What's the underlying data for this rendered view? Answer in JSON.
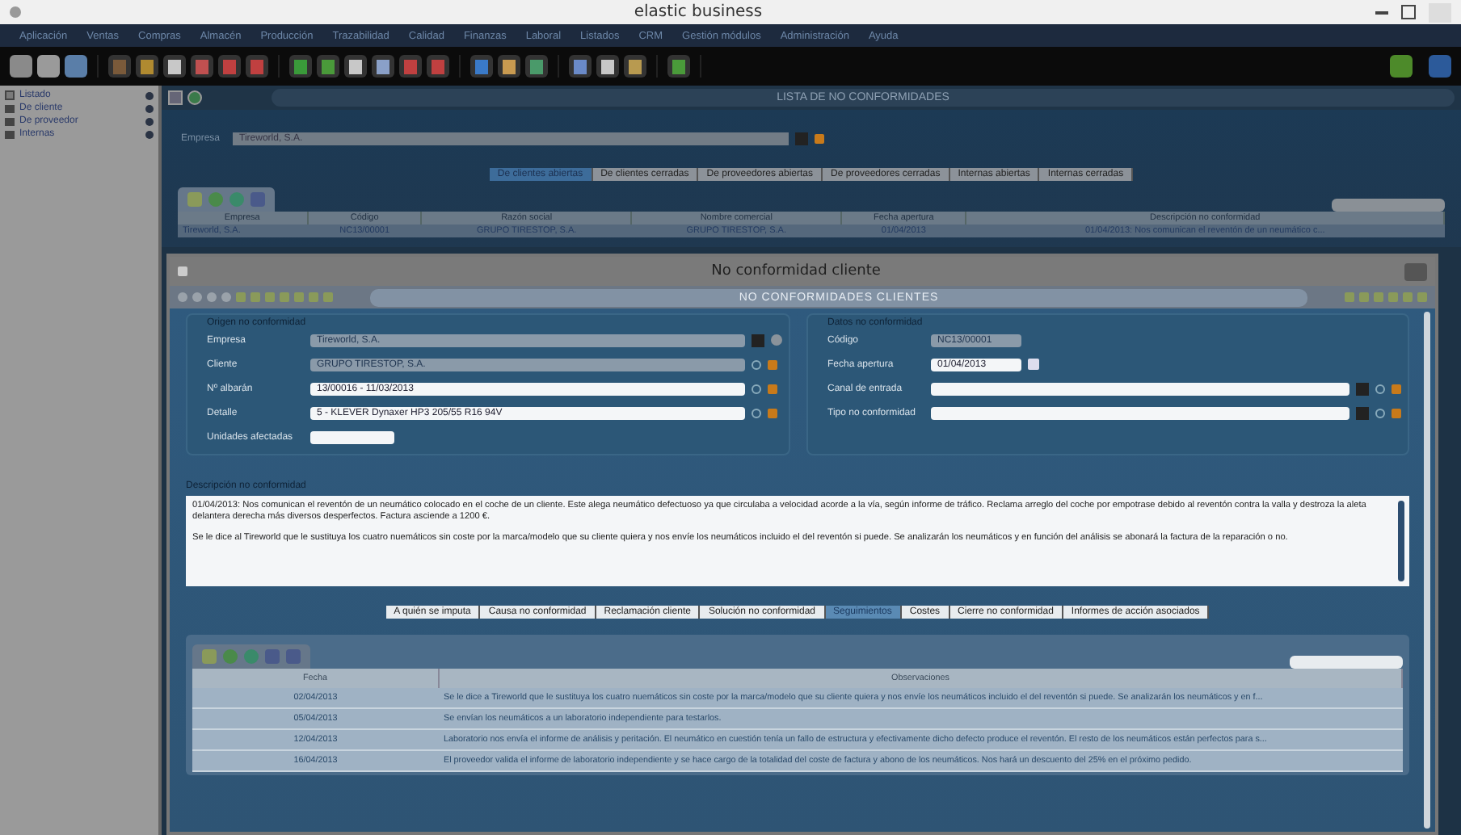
{
  "window": {
    "title": "elastic business"
  },
  "menu": [
    "Aplicación",
    "Ventas",
    "Compras",
    "Almacén",
    "Producción",
    "Trazabilidad",
    "Calidad",
    "Finanzas",
    "Laboral",
    "Listados",
    "CRM",
    "Gestión módulos",
    "Administración",
    "Ayuda"
  ],
  "sidebar": {
    "items": [
      {
        "label": "Listado",
        "kind": "list"
      },
      {
        "label": "De cliente",
        "kind": "folder"
      },
      {
        "label": "De proveedor",
        "kind": "folder"
      },
      {
        "label": "Internas",
        "kind": "folder"
      }
    ]
  },
  "list": {
    "title": "LISTA DE NO CONFORMIDADES",
    "empresa_label": "Empresa",
    "empresa_value": "Tireworld, S.A.",
    "tabs": [
      {
        "label": "De clientes abiertas",
        "selected": true
      },
      {
        "label": "De clientes cerradas",
        "selected": false
      },
      {
        "label": "De proveedores abiertas",
        "selected": false
      },
      {
        "label": "De proveedores cerradas",
        "selected": false
      },
      {
        "label": "Internas abiertas",
        "selected": false
      },
      {
        "label": "Internas cerradas",
        "selected": false
      }
    ],
    "columns": [
      "Empresa",
      "Código",
      "Razón social",
      "Nombre comercial",
      "Fecha apertura",
      "Descripción no conformidad"
    ],
    "rows": [
      [
        "Tireworld, S.A.",
        "NC13/00001",
        "GRUPO TIRESTOP, S.A.",
        "GRUPO TIRESTOP, S.A.",
        "01/04/2013",
        "01/04/2013: Nos comunican el reventón de un neumático c..."
      ]
    ]
  },
  "dialog": {
    "title": "No conformidad cliente",
    "header": "NO CONFORMIDADES CLIENTES",
    "origin": {
      "legend": "Origen no conformidad",
      "fields": [
        {
          "label": "Empresa",
          "value": "Tireworld, S.A.",
          "kind": "select",
          "disabled": true
        },
        {
          "label": "Cliente",
          "value": "GRUPO TIRESTOP, S.A.",
          "kind": "lookup",
          "disabled": true
        },
        {
          "label": "Nº albarán",
          "value": "13/00016 - 11/03/2013",
          "kind": "lookup",
          "disabled": false
        },
        {
          "label": "Detalle",
          "value": "5 - KLEVER Dynaxer HP3 205/55 R16 94V",
          "kind": "lookup",
          "disabled": false
        },
        {
          "label": "Unidades afectadas",
          "kind": "short",
          "disabled": false
        }
      ]
    },
    "data": {
      "legend": "Datos no conformidad",
      "fields": [
        {
          "label": "Código",
          "value": "NC13/00001",
          "kind": "code",
          "disabled": true
        },
        {
          "label": "Fecha apertura",
          "value": "01/04/2013",
          "kind": "date",
          "disabled": false
        },
        {
          "label": "Canal de entrada",
          "kind": "combo",
          "disabled": false
        },
        {
          "label": "Tipo no conformidad",
          "kind": "combo",
          "disabled": false
        }
      ]
    },
    "description": {
      "legend": "Descripción no conformidad",
      "paragraphs": [
        "01/04/2013: Nos comunican el reventón de un neumático colocado en el coche de un cliente. Este alega neumático defectuoso ya que circulaba a velocidad acorde a la vía, según informe de tráfico. Reclama arreglo del coche por empotrase debido al reventón contra la valla y destroza la aleta delantera derecha más diversos desperfectos. Factura asciende a 1200 €.",
        "Se le dice al Tireworld que le sustituya los cuatro nuemáticos sin coste por la marca/modelo que su cliente quiera y nos envíe los neumáticos incluido el del reventón si puede. Se analizarán los neumáticos y en función del análisis se abonará la factura de la reparación o no."
      ]
    },
    "tabs": [
      {
        "label": "A quién se imputa",
        "selected": false
      },
      {
        "label": "Causa no conformidad",
        "selected": false
      },
      {
        "label": "Reclamación cliente",
        "selected": false
      },
      {
        "label": "Solución no conformidad",
        "selected": false
      },
      {
        "label": "Seguimientos",
        "selected": true
      },
      {
        "label": "Costes",
        "selected": false
      },
      {
        "label": "Cierre no conformidad",
        "selected": false
      },
      {
        "label": "Informes de acción asociados",
        "selected": false
      }
    ],
    "columns": [
      "Fecha",
      "Observaciones"
    ],
    "rows": [
      [
        "02/04/2013",
        "Se le dice a Tireworld que le sustituya los cuatro nuemáticos sin coste por la marca/modelo que su cliente quiera y nos envíe los neumáticos incluido el del reventón si puede. Se analizarán los neumáticos y en f..."
      ],
      [
        "05/04/2013",
        "Se envían los neumáticos a un laboratorio independiente para testarlos."
      ],
      [
        "12/04/2013",
        "Laboratorio nos envía el informe de análisis y peritación. El neumático en cuestión tenía un fallo de estructura y efectivamente dicho defecto produce el reventón. El resto de los neumáticos están perfectos para s..."
      ],
      [
        "16/04/2013",
        "El proveedor valida el informe de laboratorio independiente y se hace cargo de la totalidad del coste de factura y abono de los neumáticos. Nos hará un descuento del 25% en el próximo pedido."
      ]
    ]
  }
}
